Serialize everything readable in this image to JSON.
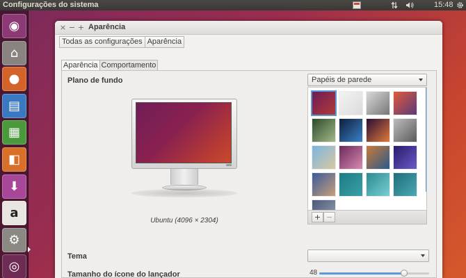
{
  "top_panel": {
    "app_title": "Configurações do sistema",
    "clock": "15:48",
    "indicators": [
      {
        "name": "keyboard-indicator-icon",
        "glyph": "⌨"
      },
      {
        "name": "network-icon",
        "glyph": "⇅"
      },
      {
        "name": "volume-icon",
        "glyph": "🔊"
      },
      {
        "name": "session-gear-icon",
        "glyph": "⚙"
      }
    ]
  },
  "launcher": {
    "items": [
      {
        "name": "dash-home-icon",
        "glyph": "◉",
        "bg": "#8c3a76"
      },
      {
        "name": "files-icon",
        "glyph": "⌂",
        "bg": "#8a8480"
      },
      {
        "name": "firefox-icon",
        "glyph": "●",
        "bg": "#d4632a"
      },
      {
        "name": "writer-icon",
        "glyph": "▤",
        "bg": "#3b78c2"
      },
      {
        "name": "calc-icon",
        "glyph": "▦",
        "bg": "#4a9a3b"
      },
      {
        "name": "impress-icon",
        "glyph": "◧",
        "bg": "#d8702a"
      },
      {
        "name": "software-center-icon",
        "glyph": "⬇",
        "bg": "#a8469a"
      },
      {
        "name": "amazon-icon",
        "glyph": "a",
        "bg": "#e9e6e2"
      },
      {
        "name": "system-settings-icon",
        "glyph": "⚙",
        "bg": "#8c8985"
      },
      {
        "name": "dvd-icon",
        "glyph": "◎",
        "bg": "#6e2c55"
      }
    ]
  },
  "window": {
    "title": "Aparência",
    "close_glyph": "×",
    "minimize_glyph": "−",
    "maximize_glyph": "+",
    "breadcrumbs": [
      "Todas as configurações",
      "Aparência"
    ],
    "tabs": [
      "Aparência",
      "Comportamento"
    ],
    "background_label": "Plano de fundo",
    "wallpaper_source": "Papéis de parede",
    "wallpaper_caption": "Ubuntu (4096 × 2304)",
    "theme_label": "Tema",
    "theme_value": "",
    "launcher_icon_size_label": "Tamanho do ícone do lançador",
    "launcher_icon_size": 48,
    "launcher_icon_size_fraction": 0.77,
    "add_glyph": "+",
    "remove_glyph": "−"
  },
  "thumbnails": [
    {
      "name": "wallpaper-thumb-ubuntu",
      "c1": "#6d1c55",
      "c2": "#b23a3a",
      "selected": true
    },
    {
      "name": "wallpaper-thumb-white",
      "c1": "#f2f2f2",
      "c2": "#dcdcdc"
    },
    {
      "name": "wallpaper-thumb-stones",
      "c1": "#d9d9d9",
      "c2": "#777777"
    },
    {
      "name": "wallpaper-thumb-abstract-red",
      "c1": "#e05a3a",
      "c2": "#5a3a7a"
    },
    {
      "name": "wallpaper-thumb-bird",
      "c1": "#2c4a2a",
      "c2": "#a5b98a"
    },
    {
      "name": "wallpaper-thumb-lights",
      "c1": "#0e1e3a",
      "c2": "#3a82c8"
    },
    {
      "name": "wallpaper-thumb-fire",
      "c1": "#2a0e32",
      "c2": "#e07a3a"
    },
    {
      "name": "wallpaper-thumb-gravel",
      "c1": "#bdbdbd",
      "c2": "#5a5a5a"
    },
    {
      "name": "wallpaper-thumb-beach",
      "c1": "#7ab4e2",
      "c2": "#d9c9a0"
    },
    {
      "name": "wallpaper-thumb-flowers",
      "c1": "#6a2a5a",
      "c2": "#d88ab0"
    },
    {
      "name": "wallpaper-thumb-sunset",
      "c1": "#c97a3a",
      "c2": "#2a5a8a"
    },
    {
      "name": "wallpaper-thumb-purple",
      "c1": "#2a1a6a",
      "c2": "#6a5ac8"
    },
    {
      "name": "wallpaper-thumb-tree",
      "c1": "#3a5a9a",
      "c2": "#c8a07a"
    },
    {
      "name": "wallpaper-thumb-teal",
      "c1": "#1e7a82",
      "c2": "#3aa0a8"
    },
    {
      "name": "wallpaper-thumb-teal-light",
      "c1": "#2a8a90",
      "c2": "#7acfd2"
    },
    {
      "name": "wallpaper-thumb-debian",
      "c1": "#1f6d7a",
      "c2": "#4aa9b2"
    },
    {
      "name": "wallpaper-thumb-rocks",
      "c1": "#4a5a7a",
      "c2": "#9aa0b2"
    }
  ]
}
